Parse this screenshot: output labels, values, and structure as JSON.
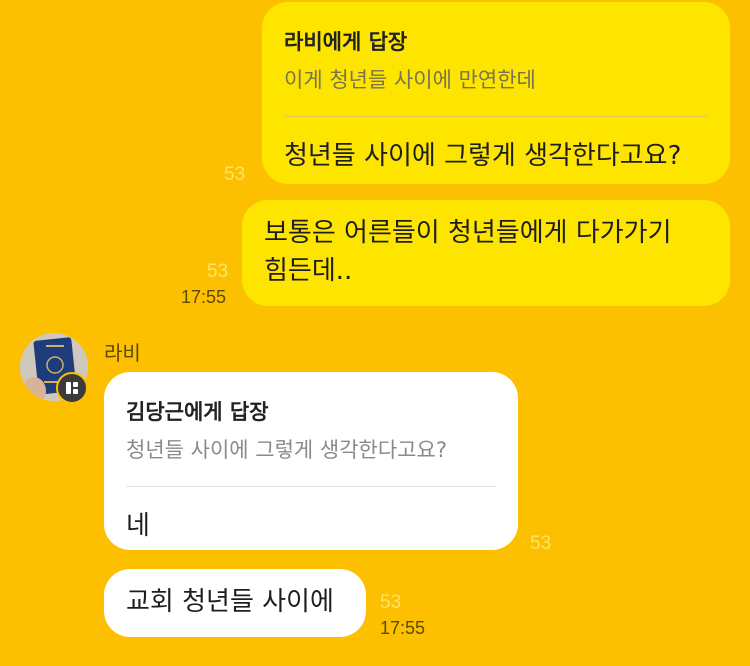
{
  "messages": {
    "m1": {
      "reply_title": "라비에게 답장",
      "reply_quote": "이게 청년들 사이에 만연한데",
      "text": "청년들 사이에 그렇게 생각한다고요?",
      "unread": "53"
    },
    "m2": {
      "line1": "보통은 어른들이 청년들에게 다가가기",
      "line2": "힘든데..",
      "unread": "53",
      "time": "17:55"
    },
    "sender_name": "라비",
    "m3": {
      "reply_title": "김당근에게 답장",
      "reply_quote": "청년들 사이에 그렇게 생각한다고요?",
      "text": "네",
      "unread": "53"
    },
    "m4": {
      "text": "교회 청년들 사이에",
      "unread": "53",
      "time": "17:55"
    }
  },
  "colors": {
    "background": "#fcc000",
    "my_bubble": "#fee500",
    "their_bubble": "#ffffff"
  }
}
